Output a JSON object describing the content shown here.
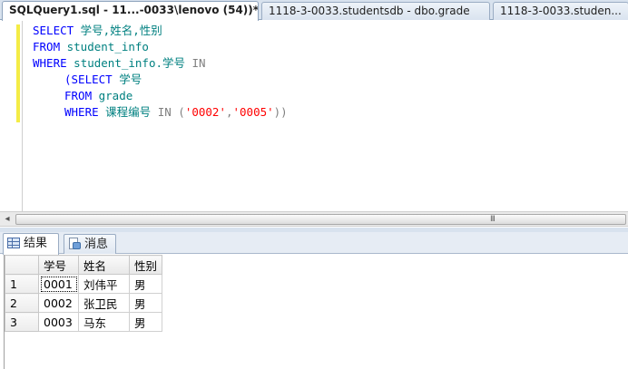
{
  "document_tabs": [
    {
      "label": "SQLQuery1.sql - 11...-0033\\lenovo (54))*",
      "active": true
    },
    {
      "label": "1118-3-0033.studentsdb - dbo.grade",
      "active": false
    },
    {
      "label": "1118-3-0033.studen...",
      "active": false
    }
  ],
  "editor": {
    "lines": [
      [
        "SELECT",
        " 学号,姓名,性别"
      ],
      [
        "FROM",
        " student_info"
      ],
      [
        "WHERE",
        " student_info.学号",
        " IN"
      ],
      [
        "(SELECT",
        " 学号"
      ],
      [
        "FROM",
        " grade"
      ],
      [
        "WHERE",
        " 课程编号",
        " IN (",
        "'0002'",
        ",",
        "'0005'",
        "))"
      ]
    ]
  },
  "scrollbar": {
    "grip": "III",
    "left_arrow": "◂"
  },
  "results_tabs": [
    {
      "label": "结果",
      "icon": "results-grid-icon",
      "active": true
    },
    {
      "label": "消息",
      "icon": "messages-icon",
      "active": false
    }
  ],
  "results": {
    "columns": [
      "学号",
      "姓名",
      "性别"
    ],
    "rows": [
      {
        "num": "1",
        "cells": [
          "0001",
          "刘伟平",
          "男"
        ]
      },
      {
        "num": "2",
        "cells": [
          "0002",
          "张卫民",
          "男"
        ]
      },
      {
        "num": "3",
        "cells": [
          "0003",
          "马东",
          "男"
        ]
      }
    ]
  },
  "colors": {
    "keyword": "#0000ff",
    "identifier": "#008080",
    "operator": "#808080",
    "string": "#ff0000",
    "change_bar": "#f4ec46"
  }
}
